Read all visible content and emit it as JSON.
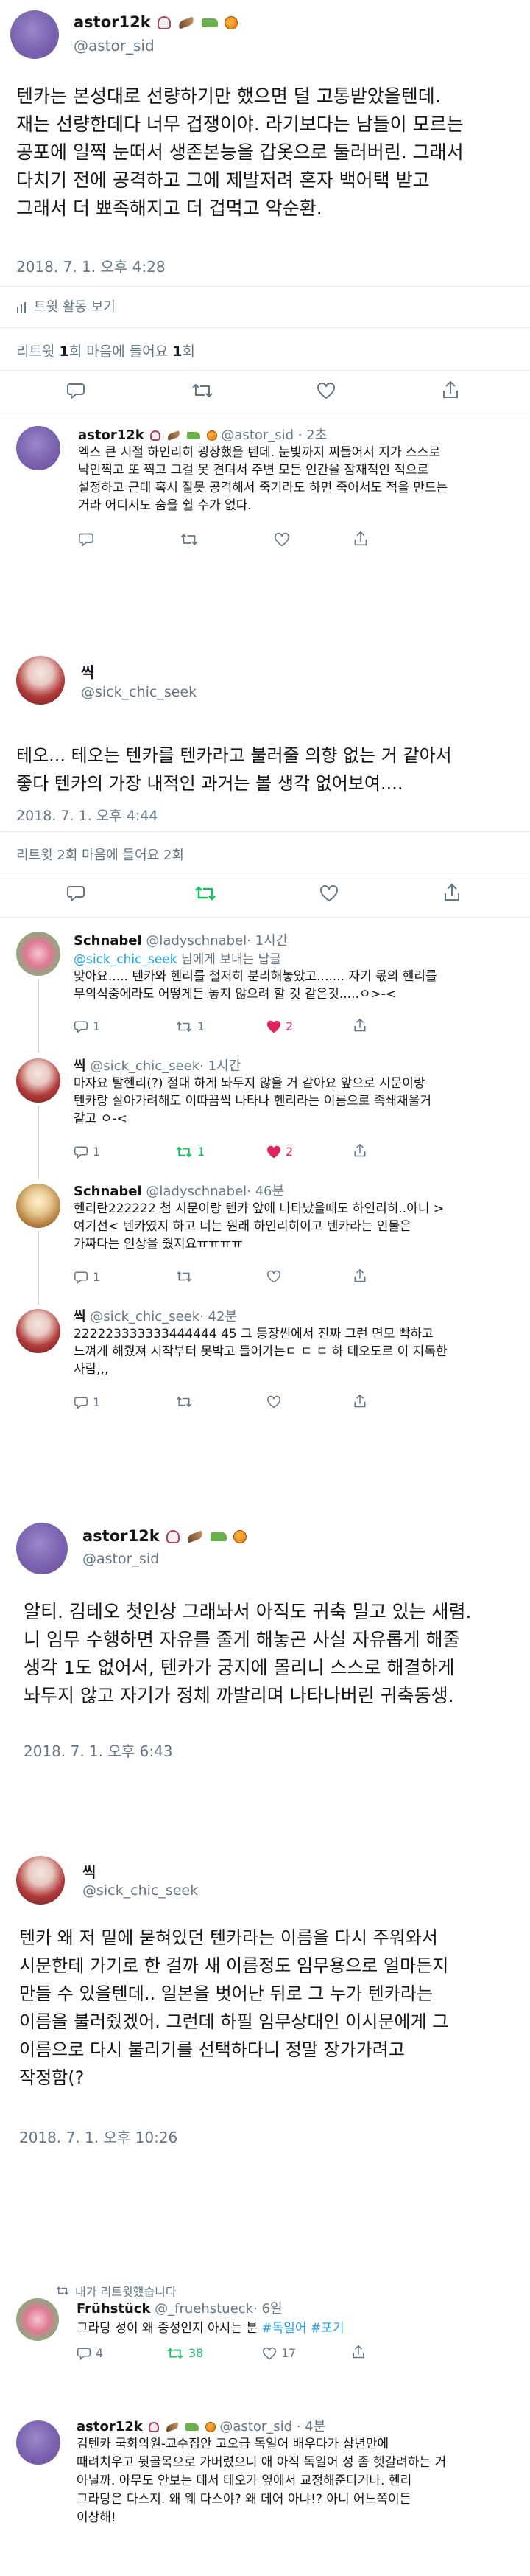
{
  "tweet1": {
    "name": "astor12k",
    "handle": "@astor_sid",
    "text_lines": [
      "텐카는 본성대로 선량하기만 했으면 덜 고통받았을텐데.",
      "재는 선량한데다 너무 겁쟁이야. 라기보다는 남들이 모르는",
      "공포에 일찍 눈떠서 생존본능을 갑옷으로 둘러버린. 그래서",
      "다치기 전에 공격하고 그에 제발저려 혼자 백어택 받고",
      "그래서 더 뾰족해지고 더 겁먹고 악순환."
    ],
    "timestamp": "2018. 7. 1. 오후 4:28",
    "activity": "트윗 활동 보기",
    "stats_retweet_label": "리트윗",
    "stats_retweet_count": "1",
    "stats_like_label": "회 마음에 들어요",
    "stats_like_count": "1",
    "stats_suffix": "회"
  },
  "reply1": {
    "name": "astor12k",
    "handle": "@astor_sid",
    "time": "· 2초",
    "text_lines": [
      "엑스 큰 시절 하인리히 굉장했을 텐데. 눈빛까지 찌들어서 지가 스스로",
      "낙인찍고 또 찍고 그걸 못 견뎌서 주변 모든 인간을 잠재적인 적으로",
      "설정하고 근데 혹시 잘못 공격해서 죽기라도 하면 죽어서도 적을 만드는",
      "거라 어디서도 숨을 쉴 수가 없다."
    ]
  },
  "tweet2": {
    "name": "씩",
    "handle": "@sick_chic_seek",
    "text_lines": [
      "테오... 테오는 텐카를 텐카라고 불러줄 의향 없는 거 같아서",
      "좋다 텐카의 가장 내적인 과거는 볼 생각 없어보여...."
    ],
    "timestamp": "2018. 7. 1. 오후 4:44",
    "stats": "리트윗 2회 마음에 들어요 2회",
    "rt_count": "2",
    "like_count": "2"
  },
  "replies2": [
    {
      "name": "Schnabel",
      "handle": "@ladyschnabel",
      "time": "· 1시간",
      "reply_to_prefix": "@sick_chic_seek",
      "reply_to_suffix": " 님에게 보내는 답글",
      "text_lines": [
        "맞아요..... 텐카와 헨리를 철저히 분리해놓았고....... 자기 몫의 헨리를",
        "무의식중에라도 어떻게든 놓지 않으려 할 것 같은것.....ㅇ>-<"
      ],
      "reply_count": "1",
      "rt_count": "1",
      "like_count": "2"
    },
    {
      "name": "씩",
      "handle": "@sick_chic_seek",
      "time": "· 1시간",
      "text_lines": [
        "마자요 탈헨리(?) 절대 하게 놔두지 않을 거 같아요 앞으로 시문이랑",
        "텐카랑 살아가려해도 이따끔씩 나타나 헨리라는 이름으로 족쇄채울거",
        "같고 ㅇ-<"
      ],
      "reply_count": "1",
      "rt_count": "1",
      "like_count": "2"
    },
    {
      "name": "Schnabel",
      "handle": "@ladyschnabel",
      "time": "· 46분",
      "text_lines": [
        "헨리란222222 첨 시문이랑 텐카 앞에 나타났을때도 하인리히..아니 >",
        "여기선< 텐카였지 하고 너는 원래 하인리히이고 텐카라는 인물은",
        "가짜다는 인상을 줬지요ㅠㅠㅠㅠ"
      ],
      "reply_count": "1",
      "rt_count": "",
      "like_count": ""
    },
    {
      "name": "씩",
      "handle": "@sick_chic_seek",
      "time": "· 42분",
      "text_lines": [
        "222223333333444444 45 그 등장씬에서 진짜 그런 면모 빡하고",
        "느껴게 해줬져 시작부터 못박고 들어가는ㄷ ㄷ ㄷ 하 테오도르 이 지독한",
        "사람,,,"
      ],
      "reply_count": "1",
      "rt_count": "",
      "like_count": ""
    }
  ],
  "tweet3": {
    "name": "astor12k",
    "handle": "@astor_sid",
    "text_lines": [
      "알티. 김테오 첫인상 그래놔서 아직도 귀축 밀고 있는 새렴.",
      "니 임무 수행하면 자유를 줄게 해놓곤 사실 자유롭게 해줄",
      "생각 1도 없어서, 텐카가 궁지에 몰리니 스스로 해결하게",
      "놔두지 않고 자기가 정체 까발리며 나타나버린 귀축동생."
    ],
    "timestamp": "2018. 7. 1. 오후 6:43"
  },
  "tweet4": {
    "name": "씩",
    "handle": "@sick_chic_seek",
    "text_lines": [
      "텐카 왜 저 밑에 묻혀있던 텐카라는 이름을 다시 주워와서",
      "시문한테 가기로 한 걸까 새 이름정도 임무용으로 얼마든지",
      "만들 수 있을텐데.. 일본을 벗어난 뒤로 그 누가 텐카라는",
      "이름을 불러줬겠어. 그런데 하필 임무상대인 이시문에게 그",
      "이름으로 다시 불리기를 선택하다니 정말 장가가려고",
      "작정함(?"
    ],
    "timestamp": "2018. 7. 1. 오후 10:26"
  },
  "retweet": {
    "label": "내가 리트윗했습니다",
    "name": "Frühstück",
    "handle": "@_fruehstueck",
    "time": "· 6일",
    "text": "그라탕 성이 왜 중성인지 아시는 분 ",
    "tags": "#독일어 #포기",
    "reply_count": "4",
    "rt_count": "38",
    "like_count": "17"
  },
  "tweet5": {
    "name": "astor12k",
    "handle": "@astor_sid",
    "time": "· 4분",
    "text_lines": [
      "김텐카 국회의원-교수집안 고오급 독일어 배우다가 삼년만에",
      "때려치우고 뒷골목으로 가버렸으니 애 아직 독일어 성 좀 헷갈려하는 거",
      "아닐까. 아무도 안보는 데서 테오가 옆에서 교정해준다거나. 헨리",
      "그라탕은 다스지. 왜 웨 다스야? 왜 데어 아냐!? 아니 어느쪽이든",
      "이상해!"
    ]
  },
  "icons": [
    "reply-icon",
    "retweet-icon",
    "like-icon",
    "share-icon",
    "stats-icon"
  ],
  "colors": {
    "retweet_active": "#17bf63",
    "like_active": "#e0245e",
    "link": "#1da1f2",
    "meta": "#657786"
  }
}
